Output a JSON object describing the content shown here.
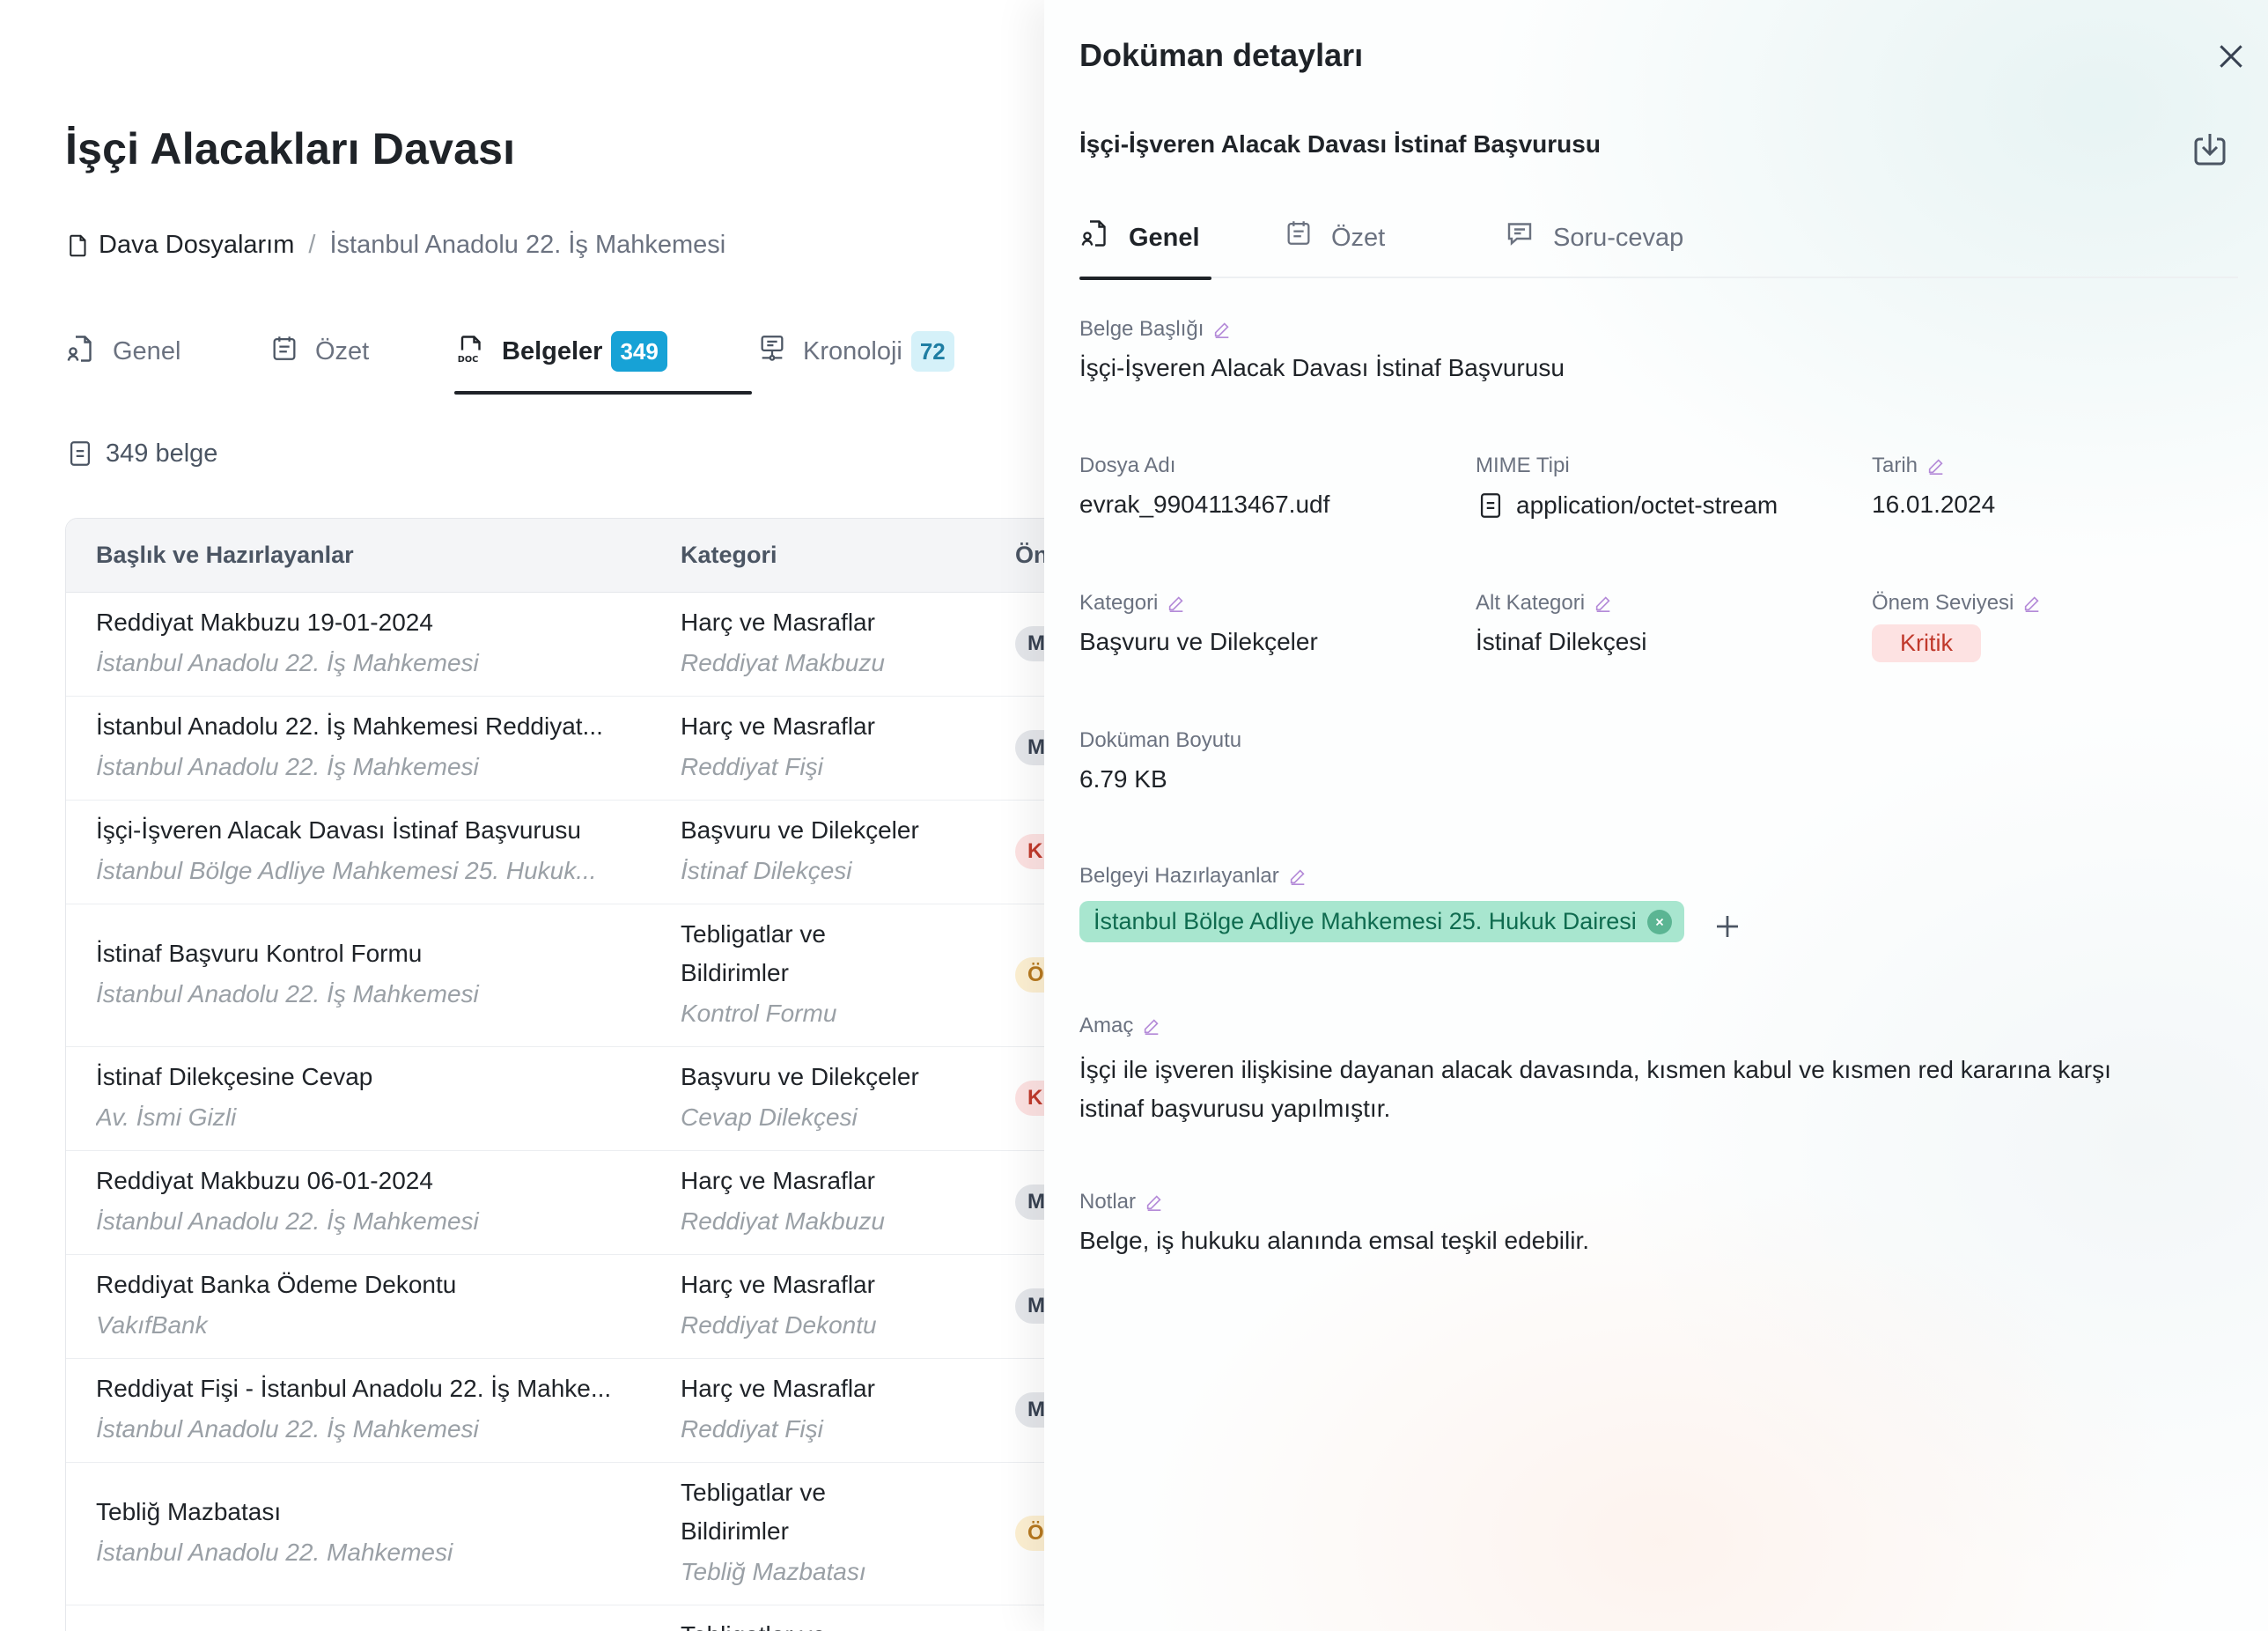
{
  "page": {
    "title": "İşçi Alacakları Davası",
    "breadcrumb": {
      "root": "Dava Dosyalarım",
      "separator": "/",
      "current": "İstanbul Anadolu 22. İş Mahkemesi"
    },
    "tabs": [
      {
        "label": "Genel",
        "icon": "file-user-icon"
      },
      {
        "label": "Özet",
        "icon": "calendar-icon"
      },
      {
        "label": "Belgeler",
        "icon": "doc-icon",
        "badge": "349"
      },
      {
        "label": "Kronoloji",
        "icon": "timeline-icon",
        "badge": "72"
      }
    ],
    "doc_count": "349 belge"
  },
  "table": {
    "columns": [
      "Başlık ve Hazırlayanlar",
      "Kategori",
      "Ön"
    ],
    "rows": [
      {
        "title": "Reddiyat Makbuzu 19-01-2024",
        "author": "İstanbul Anadolu 22. İş Mahkemesi",
        "category": "Harç ve Masraflar",
        "subcategory": "Reddiyat Makbuzu",
        "priority": "M"
      },
      {
        "title": "İstanbul Anadolu 22. İş Mahkemesi Reddiyat...",
        "author": "İstanbul Anadolu 22. İş Mahkemesi",
        "category": "Harç ve Masraflar",
        "subcategory": "Reddiyat Fişi",
        "priority": "M"
      },
      {
        "title": "İşçi-İşveren Alacak Davası İstinaf Başvurusu",
        "author": "İstanbul Bölge Adliye Mahkemesi 25. Hukuk...",
        "category": "Başvuru ve Dilekçeler",
        "subcategory": "İstinaf Dilekçesi",
        "priority": "Kr"
      },
      {
        "title": "İstinaf Başvuru Kontrol Formu",
        "author": "İstanbul Anadolu 22. İş Mahkemesi",
        "category": "Tebligatlar ve Bildirimler",
        "subcategory": "Kontrol Formu",
        "priority": "Ön"
      },
      {
        "title": "İstinaf Dilekçesine Cevap",
        "author": "Av.  İsmi Gizli",
        "category": "Başvuru ve Dilekçeler",
        "subcategory": "Cevap Dilekçesi",
        "priority": "Kr"
      },
      {
        "title": "Reddiyat Makbuzu 06-01-2024",
        "author": "İstanbul Anadolu 22. İş Mahkemesi",
        "category": "Harç ve Masraflar",
        "subcategory": "Reddiyat Makbuzu",
        "priority": "M"
      },
      {
        "title": "Reddiyat Banka Ödeme Dekontu",
        "author": "VakıfBank",
        "category": "Harç ve Masraflar",
        "subcategory": "Reddiyat Dekontu",
        "priority": "M"
      },
      {
        "title": "Reddiyat Fişi - İstanbul Anadolu 22. İş Mahke...",
        "author": "İstanbul Anadolu 22. İş Mahkemesi",
        "category": "Harç ve Masraflar",
        "subcategory": "Reddiyat Fişi",
        "priority": "M"
      },
      {
        "title": "Tebliğ Mazbatası",
        "author": "İstanbul Anadolu 22. Mahkemesi",
        "category": "Tebligatlar ve Bildirimler",
        "subcategory": "Tebliğ Mazbatası",
        "priority": "Ön"
      },
      {
        "title": "",
        "author": "",
        "category": "Tebligatlar ve",
        "subcategory": "",
        "priority": ""
      }
    ]
  },
  "drawer": {
    "title": "Doküman detayları",
    "document_heading": "İşçi-İşveren Alacak Davası İstinaf Başvurusu",
    "tabs": [
      {
        "label": "Genel",
        "icon": "file-user-icon"
      },
      {
        "label": "Özet",
        "icon": "calendar-icon"
      },
      {
        "label": "Soru-cevap",
        "icon": "chat-icon"
      }
    ],
    "fields": {
      "title": {
        "label": "Belge Başlığı",
        "value": "İşçi-İşveren Alacak Davası İstinaf Başvurusu"
      },
      "file_name": {
        "label": "Dosya Adı",
        "value": "evrak_9904113467.udf"
      },
      "mime": {
        "label": "MIME Tipi",
        "value": "application/octet-stream"
      },
      "date": {
        "label": "Tarih",
        "value": "16.01.2024"
      },
      "category": {
        "label": "Kategori",
        "value": "Başvuru ve Dilekçeler"
      },
      "subcategory": {
        "label": "Alt Kategori",
        "value": "İstinaf Dilekçesi"
      },
      "importance": {
        "label": "Önem Seviyesi",
        "value": "Kritik"
      },
      "size": {
        "label": "Doküman Boyutu",
        "value": "6.79 KB"
      },
      "authors": {
        "label": "Belgeyi Hazırlayanlar",
        "value": "İstanbul Bölge Adliye Mahkemesi 25. Hukuk Dairesi"
      },
      "purpose": {
        "label": "Amaç",
        "value": "İşçi ile işveren ilişkisine dayanan alacak davasında, kısmen kabul ve kısmen red kararına karşı istinaf başvurusu yapılmıştır."
      },
      "notes": {
        "label": "Notlar",
        "value": "Belge, iş hukuku alanında emsal teşkil edebilir."
      }
    }
  },
  "colors": {
    "accent_badge": "#17a2d6",
    "critical_bg": "#fde2e2",
    "critical_text": "#c0392b",
    "chip_bg": "#a8e6cf",
    "edit_icon": "#b48ad8"
  }
}
